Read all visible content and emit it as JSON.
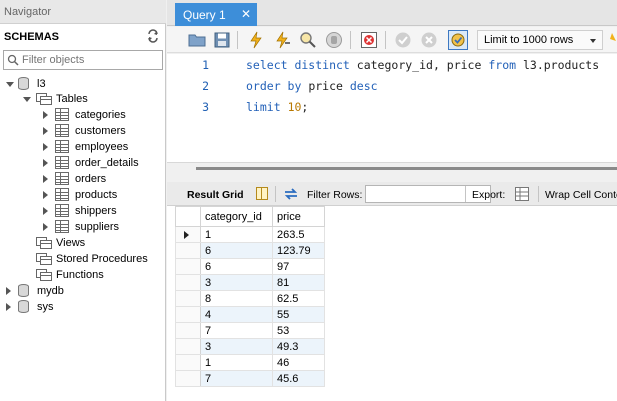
{
  "navigator": {
    "title": "Navigator",
    "schemas_label": "SCHEMAS",
    "filter_placeholder": "Filter objects",
    "tree": {
      "schema_l3": "l3",
      "tables_folder": "Tables",
      "tables": [
        "categories",
        "customers",
        "employees",
        "order_details",
        "orders",
        "products",
        "shippers",
        "suppliers"
      ],
      "views": "Views",
      "stored_procedures": "Stored Procedures",
      "functions": "Functions",
      "other_schemas": [
        "mydb",
        "sys"
      ]
    }
  },
  "editor_tab": {
    "label": "Query 1",
    "close": "✕"
  },
  "toolbar": {
    "limit_label": "Limit to 1000 rows"
  },
  "editor": {
    "line_numbers": [
      "1",
      "2",
      "3"
    ],
    "line1": {
      "kw1": "select distinct",
      "rest": " category_id, price ",
      "kw2": "from",
      "tail": " l3.products"
    },
    "line2": {
      "kw1": "order by",
      "mid": " price ",
      "kw2": "desc"
    },
    "line3": {
      "kw1": "limit",
      "num": "10",
      "tail": ";"
    }
  },
  "result_bar": {
    "result_grid": "Result Grid",
    "filter_rows": "Filter Rows:",
    "export": "Export:",
    "wrap_cell": "Wrap Cell Conte"
  },
  "grid": {
    "columns": [
      "category_id",
      "price"
    ],
    "rows": [
      [
        "1",
        "263.5"
      ],
      [
        "6",
        "123.79"
      ],
      [
        "6",
        "97"
      ],
      [
        "3",
        "81"
      ],
      [
        "8",
        "62.5"
      ],
      [
        "4",
        "55"
      ],
      [
        "7",
        "53"
      ],
      [
        "3",
        "49.3"
      ],
      [
        "1",
        "46"
      ],
      [
        "7",
        "45.6"
      ]
    ]
  },
  "colors": {
    "tab_active": "#3d8ed9",
    "keyword": "#2361b8",
    "number": "#b87800",
    "row_alt": "#ecf4fb"
  }
}
